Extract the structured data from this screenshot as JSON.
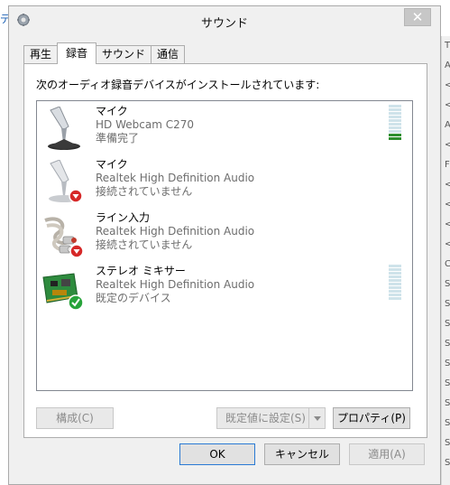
{
  "window": {
    "title": "サウンド",
    "close_glyph": "✕"
  },
  "background": {
    "left_fragment": "デ",
    "right_chars": [
      "T",
      "A",
      "<",
      "<",
      "A",
      "<",
      "F",
      "<",
      "<",
      "<",
      "<",
      "C",
      "S",
      "S",
      "S",
      "S",
      "S",
      "S",
      "S",
      "S",
      "S",
      "S"
    ]
  },
  "tabs": [
    {
      "label": "再生",
      "active": false
    },
    {
      "label": "録音",
      "active": true
    },
    {
      "label": "サウンド",
      "active": false
    },
    {
      "label": "通信",
      "active": false
    }
  ],
  "panel": {
    "description": "次のオーディオ録音デバイスがインストールされています:"
  },
  "devices": [
    {
      "name": "マイク",
      "description": "HD Webcam C270",
      "status": "準備完了",
      "icon": "webcam-microphone-icon",
      "level_meter": true,
      "level": 0.2
    },
    {
      "name": "マイク",
      "description": "Realtek High Definition Audio",
      "status": "接続されていません",
      "icon": "microphone-icon",
      "badge": "disconnected-badge-icon",
      "level_meter": false
    },
    {
      "name": "ライン入力",
      "description": "Realtek High Definition Audio",
      "status": "接続されていません",
      "icon": "line-in-cable-icon",
      "badge": "disconnected-badge-icon",
      "level_meter": false
    },
    {
      "name": "ステレオ ミキサー",
      "description": "Realtek High Definition Audio",
      "status": "既定のデバイス",
      "icon": "sound-card-icon",
      "badge": "default-check-badge-icon",
      "level_meter": true,
      "level": 0
    }
  ],
  "buttons": {
    "configure": "構成(C)",
    "set_default": "既定値に設定(S)",
    "properties": "プロパティ(P)",
    "ok": "OK",
    "cancel": "キャンセル",
    "apply": "適用(A)"
  },
  "colors": {
    "meter_on": "#2f8f2f",
    "meter_off": "#cfe3ea",
    "badge_error": "#d62828",
    "badge_ok": "#27a33a"
  }
}
